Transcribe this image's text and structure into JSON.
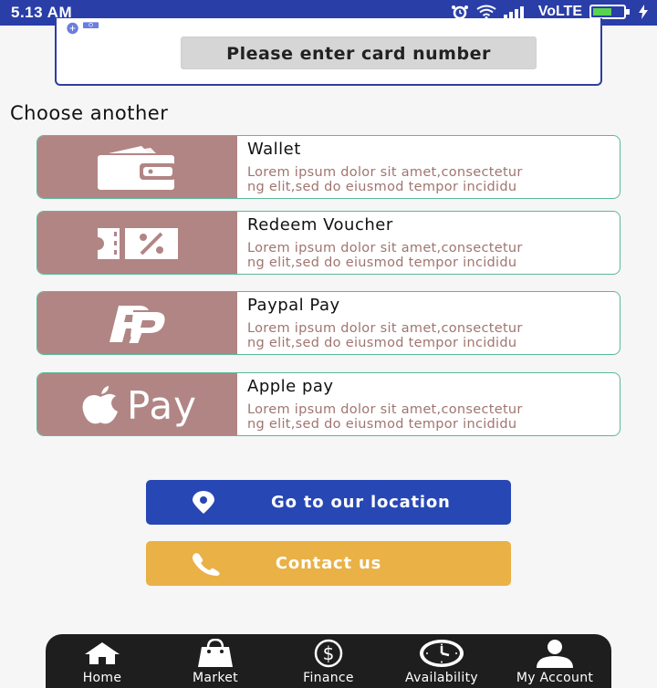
{
  "status_bar": {
    "time": "5.13 AM",
    "network": "VoLTE"
  },
  "card_entry": {
    "prompt": "Please enter card number"
  },
  "section_title": "Choose another",
  "payment_methods": [
    {
      "title": "Wallet",
      "desc_line1": "Lorem ipsum dolor sit amet,consectetur",
      "desc_line2": "ng elit,sed do eiusmod tempor incididu",
      "icon": "wallet-icon"
    },
    {
      "title": "Redeem Voucher",
      "desc_line1": "Lorem ipsum dolor sit amet,consectetur",
      "desc_line2": "ng elit,sed do eiusmod tempor incididu",
      "icon": "voucher-icon"
    },
    {
      "title": "Paypal Pay",
      "desc_line1": "Lorem ipsum dolor sit amet,consectetur",
      "desc_line2": "ng elit,sed do eiusmod tempor incididu",
      "icon": "paypal-icon"
    },
    {
      "title": "Apple pay",
      "desc_line1": "Lorem ipsum dolor sit amet,consectetur",
      "desc_line2": "ng elit,sed do eiusmod tempor incididu",
      "icon": "apple-pay-icon",
      "icon_text": "Pay"
    }
  ],
  "buttons": {
    "location": "Go to our location",
    "contact": "Contact us"
  },
  "nav": [
    {
      "label": "Home"
    },
    {
      "label": "Market"
    },
    {
      "label": "Finance"
    },
    {
      "label": "Availability"
    },
    {
      "label": "My Account"
    }
  ],
  "colors": {
    "status_bar": "#2a3ea8",
    "method_icon_bg": "#b18584",
    "location_button": "#2747b4",
    "contact_button": "#e9b146",
    "nav_bg": "#1e1e1e"
  }
}
